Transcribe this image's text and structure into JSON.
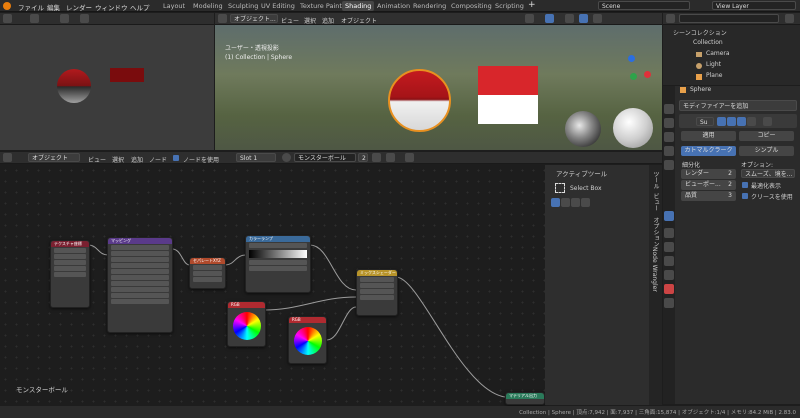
{
  "menu": {
    "file": "ファイル",
    "edit": "編集",
    "render": "レンダー",
    "window": "ウィンドウ",
    "help": "ヘルプ"
  },
  "workspaces": [
    "Layout",
    "Modeling",
    "Sculpting",
    "UV Editing",
    "Texture Paint",
    "Shading",
    "Animation",
    "Rendering",
    "Compositing",
    "Scripting"
  ],
  "active_workspace": "Shading",
  "scene": "Scene",
  "view_layer": "View Layer",
  "left_view": {
    "mode": "グロー...",
    "options": "オプション"
  },
  "viewport": {
    "mode": "オブジェクト...",
    "view": "ビュー",
    "select": "選択",
    "add": "追加",
    "object": "オブジェクト",
    "perspective": "ユーザー・透視投影",
    "collection": "(1) Collection | Sphere"
  },
  "outliner": {
    "root": "シーンコレクション",
    "collection": "Collection",
    "camera": "Camera",
    "light": "Light",
    "plane": "Plane"
  },
  "properties": {
    "object_name": "Sphere",
    "add_modifier": "モディファイアーを追加",
    "mod_name": "Su",
    "apply": "適用",
    "copy": "コピー",
    "catmull": "カトマルクラーク",
    "simple": "シンプル",
    "subdiv": "細分化",
    "render_label": "レンダー",
    "render_val": "2",
    "viewport_label": "ビューポー...",
    "viewport_val": "2",
    "quality_label": "品質",
    "quality_val": "3",
    "options": "オプション:",
    "uv_smooth": "スムーズ、境を...",
    "optimal": "最適化表示",
    "use_crease": "クリースを使用"
  },
  "node_editor": {
    "mode": "オブジェクト",
    "view": "ビュー",
    "select": "選択",
    "add": "追加",
    "node": "ノード",
    "use_nodes": "ノードを使用",
    "slot": "Slot 1",
    "material": "モンスターボール",
    "users": "2",
    "label": "モンスターボール"
  },
  "toolpanel": {
    "title": "アクティブツール",
    "tool": "Select Box",
    "tab_tool": "ツール",
    "tab_view": "ビュー",
    "tab_options": "オプション",
    "tab_wrangler": "Node Wrangler"
  },
  "nodes": {
    "texcoord": "テクスチャ座標",
    "mapping": "マッピング",
    "sep": "セパレートXYZ",
    "ramp": "カラーランプ",
    "mix": "ミックスシェーダー",
    "rgb1": "RGB",
    "rgb2": "RGB",
    "output": "マテリアル出力"
  },
  "status": "Collection | Sphere | 頂点:7,942 | 面:7,937 | 三角面:15,874 | オブジェクト:1/4 | メモリ:84.2 MiB | 2.83.0"
}
